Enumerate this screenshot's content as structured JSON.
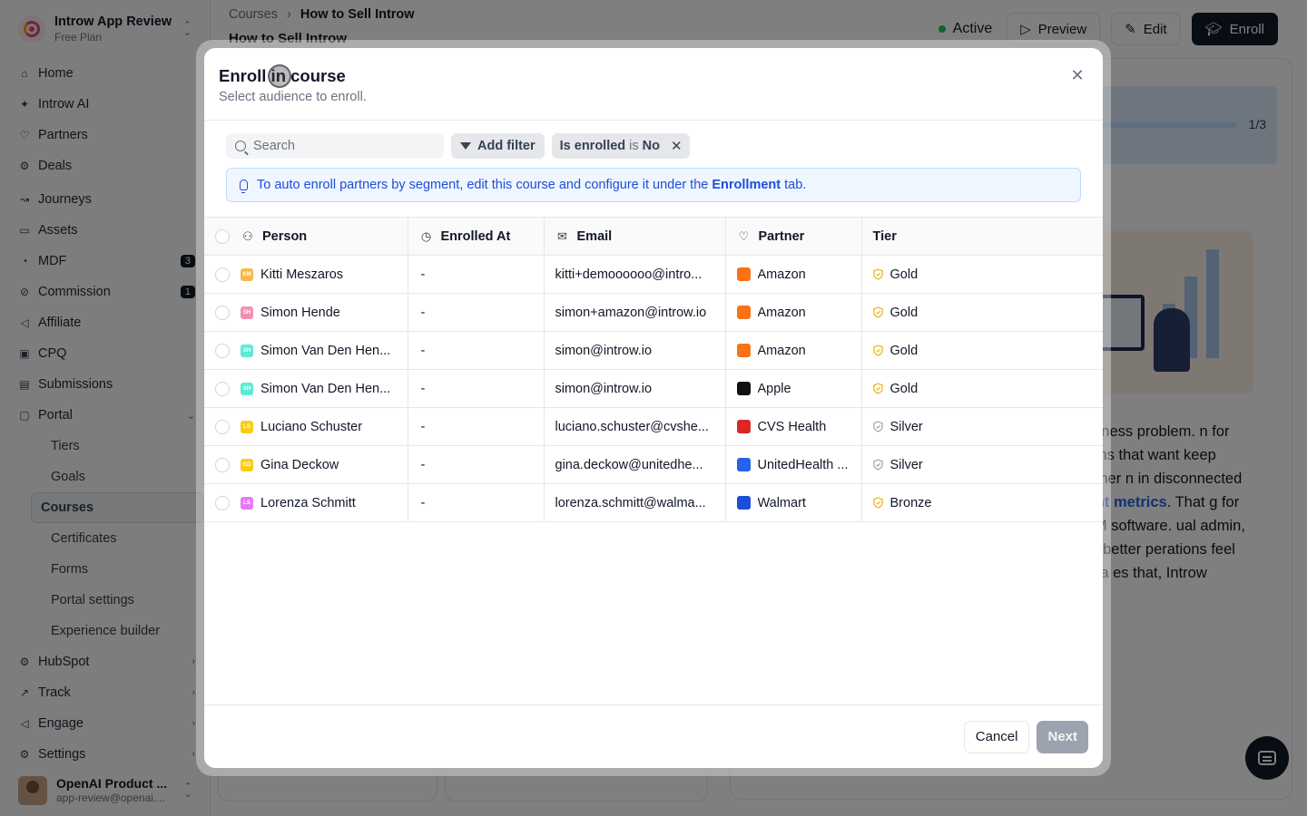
{
  "workspace": {
    "name": "Introw App Review",
    "plan": "Free Plan"
  },
  "sidebar": {
    "items": [
      {
        "label": "Home",
        "icon": "home-icon",
        "glyph": "⌂"
      },
      {
        "label": "Introw AI",
        "icon": "sparkle-icon",
        "glyph": "✦"
      },
      {
        "label": "Partners",
        "icon": "handshake-icon",
        "glyph": "♡"
      },
      {
        "label": "Deals",
        "icon": "hubspot-icon",
        "glyph": "⚙"
      },
      {
        "label": "Journeys",
        "icon": "journey-icon",
        "glyph": "↝"
      },
      {
        "label": "Assets",
        "icon": "folder-icon",
        "glyph": "▭"
      },
      {
        "label": "MDF",
        "icon": "money-icon",
        "glyph": "◔",
        "badge": "3"
      },
      {
        "label": "Commission",
        "icon": "commission-icon",
        "glyph": "⊘",
        "badge": "1"
      },
      {
        "label": "Affiliate",
        "icon": "megaphone-icon",
        "glyph": "◁"
      },
      {
        "label": "CPQ",
        "icon": "quote-icon",
        "glyph": "▣"
      },
      {
        "label": "Submissions",
        "icon": "inbox-icon",
        "glyph": "▤"
      },
      {
        "label": "Portal",
        "icon": "portal-icon",
        "glyph": "▢",
        "arrow": "⌄"
      }
    ],
    "portal_sub": [
      "Tiers",
      "Goals",
      "Courses",
      "Certificates",
      "Forms",
      "Portal settings",
      "Experience builder"
    ],
    "bottom_items": [
      {
        "label": "HubSpot",
        "icon": "hubspot-icon",
        "glyph": "⚙",
        "arrow": "›"
      },
      {
        "label": "Track",
        "icon": "chart-icon",
        "glyph": "↗",
        "arrow": "›"
      },
      {
        "label": "Engage",
        "icon": "megaphone-icon",
        "glyph": "◁",
        "arrow": "›"
      },
      {
        "label": "Settings",
        "icon": "gear-icon",
        "glyph": "⚙",
        "arrow": "›"
      }
    ]
  },
  "user": {
    "name": "OpenAI Product ...",
    "email": "app-review@openai...."
  },
  "header": {
    "breadcrumb_root": "Courses",
    "breadcrumb_sep": "›",
    "breadcrumb_current": "How to Sell Introw",
    "title": "How to Sell Introw",
    "status": "Active",
    "preview_label": "Preview",
    "edit_label": "Edit",
    "enroll_label": "Enroll"
  },
  "background_card": {
    "progress_label": "1/3",
    "progress_fraction": 0.33,
    "text_before": "business problem. n for teams that want keep partner n in disconnected ",
    "link_text": "ment metrics",
    "text_after": ". That g for PRM software. ual admin, and better perations feel like a es that, Introw"
  },
  "modal": {
    "title": "Enroll in course",
    "subtitle": "Select audience to enroll.",
    "close_glyph": "✕",
    "search_placeholder": "Search",
    "add_filter_label": "Add filter",
    "filter_chip": {
      "field": "Is enrolled",
      "op": "is",
      "value": "No"
    },
    "info_before": "To auto enroll partners by segment, edit this course and configure it under the ",
    "info_link": "Enrollment",
    "info_after": " tab.",
    "columns": {
      "person": "Person",
      "enrolled_at": "Enrolled At",
      "email": "Email",
      "partner": "Partner",
      "tier": "Tier"
    },
    "rows": [
      {
        "initials": "KM",
        "avatar_color": "#f5b94a",
        "person": "Kitti Meszaros",
        "enrolled_at": "-",
        "email": "kitti+demoooooo@intro...",
        "partner": "Amazon",
        "partner_color": "#f97316",
        "tier": "Gold",
        "tier_color": "#eab308"
      },
      {
        "initials": "SH",
        "avatar_color": "#f48fb1",
        "person": "Simon Hende",
        "enrolled_at": "-",
        "email": "simon+amazon@introw.io",
        "partner": "Amazon",
        "partner_color": "#f97316",
        "tier": "Gold",
        "tier_color": "#eab308"
      },
      {
        "initials": "SH",
        "avatar_color": "#5eead4",
        "person": "Simon Van Den Hen...",
        "enrolled_at": "-",
        "email": "simon@introw.io",
        "partner": "Amazon",
        "partner_color": "#f97316",
        "tier": "Gold",
        "tier_color": "#eab308"
      },
      {
        "initials": "SH",
        "avatar_color": "#5eead4",
        "person": "Simon Van Den Hen...",
        "enrolled_at": "-",
        "email": "simon@introw.io",
        "partner": "Apple",
        "partner_color": "#111111",
        "tier": "Gold",
        "tier_color": "#eab308"
      },
      {
        "initials": "LS",
        "avatar_color": "#facc15",
        "person": "Luciano Schuster",
        "enrolled_at": "-",
        "email": "luciano.schuster@cvshe...",
        "partner": "CVS Health",
        "partner_color": "#dc2626",
        "tier": "Silver",
        "tier_color": "#9ca3af"
      },
      {
        "initials": "GD",
        "avatar_color": "#facc15",
        "person": "Gina Deckow",
        "enrolled_at": "-",
        "email": "gina.deckow@unitedhe...",
        "partner": "UnitedHealth ...",
        "partner_color": "#2563eb",
        "tier": "Silver",
        "tier_color": "#9ca3af"
      },
      {
        "initials": "LS",
        "avatar_color": "#e879f9",
        "person": "Lorenza Schmitt",
        "enrolled_at": "-",
        "email": "lorenza.schmitt@walma...",
        "partner": "Walmart",
        "partner_color": "#1d4ed8",
        "tier": "Bronze",
        "tier_color": "#eab308"
      }
    ],
    "cancel_label": "Cancel",
    "next_label": "Next"
  }
}
